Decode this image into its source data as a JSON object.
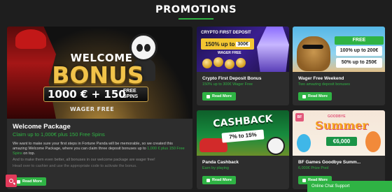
{
  "header": {
    "title": "PROMOTIONS"
  },
  "featured": {
    "art": {
      "welcome": "WELCOME",
      "bonus": "BONUS",
      "amount": "1000 € + 150",
      "spins": "FREE SPINS",
      "wager": "WAGER FREE"
    },
    "title": "Welcome Package",
    "subtitle": "Claim up to 1,000€ plus 150 Free Spins",
    "desc_a": "We want to make sure your first steps in Fortune Panda will be memorable, so we created this amazing Welcome Package, where you can claim three deposit bonuses up to ",
    "desc_hl": "1,000 € plus 150 Free Spins",
    "desc_b": " on top.",
    "desc2": "And to make them even better, all bonuses in our welcome package are wager free!",
    "desc3": "Head over to cashier and use the appropriate code to activate the bonus.",
    "button": "Read More"
  },
  "cards": [
    {
      "art": {
        "head": "CRYPTO FIRST DEPOSIT BONUS",
        "pct": "150% up to",
        "amount": "300€",
        "wager": "WAGER FREE"
      },
      "title": "Crypto First Deposit Bonus",
      "subtitle": "150% up to 300€ Wager Free",
      "button": "Read More"
    },
    {
      "art": {
        "free": "FREE",
        "friday": "100% up to 200€",
        "sunday": "50% up to 250€"
      },
      "title": "Wager Free Weekend",
      "subtitle": "Two amazing deposit bonuses",
      "button": "Read More"
    },
    {
      "art": {
        "title": "CASHBACK",
        "pct": "7% to 15%"
      },
      "title": "Panda Cashback",
      "subtitle": "Earn by playing",
      "button": "Read More"
    },
    {
      "art": {
        "goodbye": "GOODBYE",
        "summer": "Summer",
        "prize": "€6,000",
        "bf": "BF"
      },
      "title": "BF Games Goodbye Summ...",
      "subtitle": "6,000€ Prize Pool",
      "button": "Read More"
    }
  ],
  "chat": {
    "label": "Online Chat Support"
  },
  "colors": {
    "accent": "#2fb344",
    "background": "#1e1e1e",
    "card": "#2d2d2d",
    "search": "#e23a5a"
  },
  "icons": {
    "search": "search-icon",
    "read_more": "doc-icon"
  }
}
